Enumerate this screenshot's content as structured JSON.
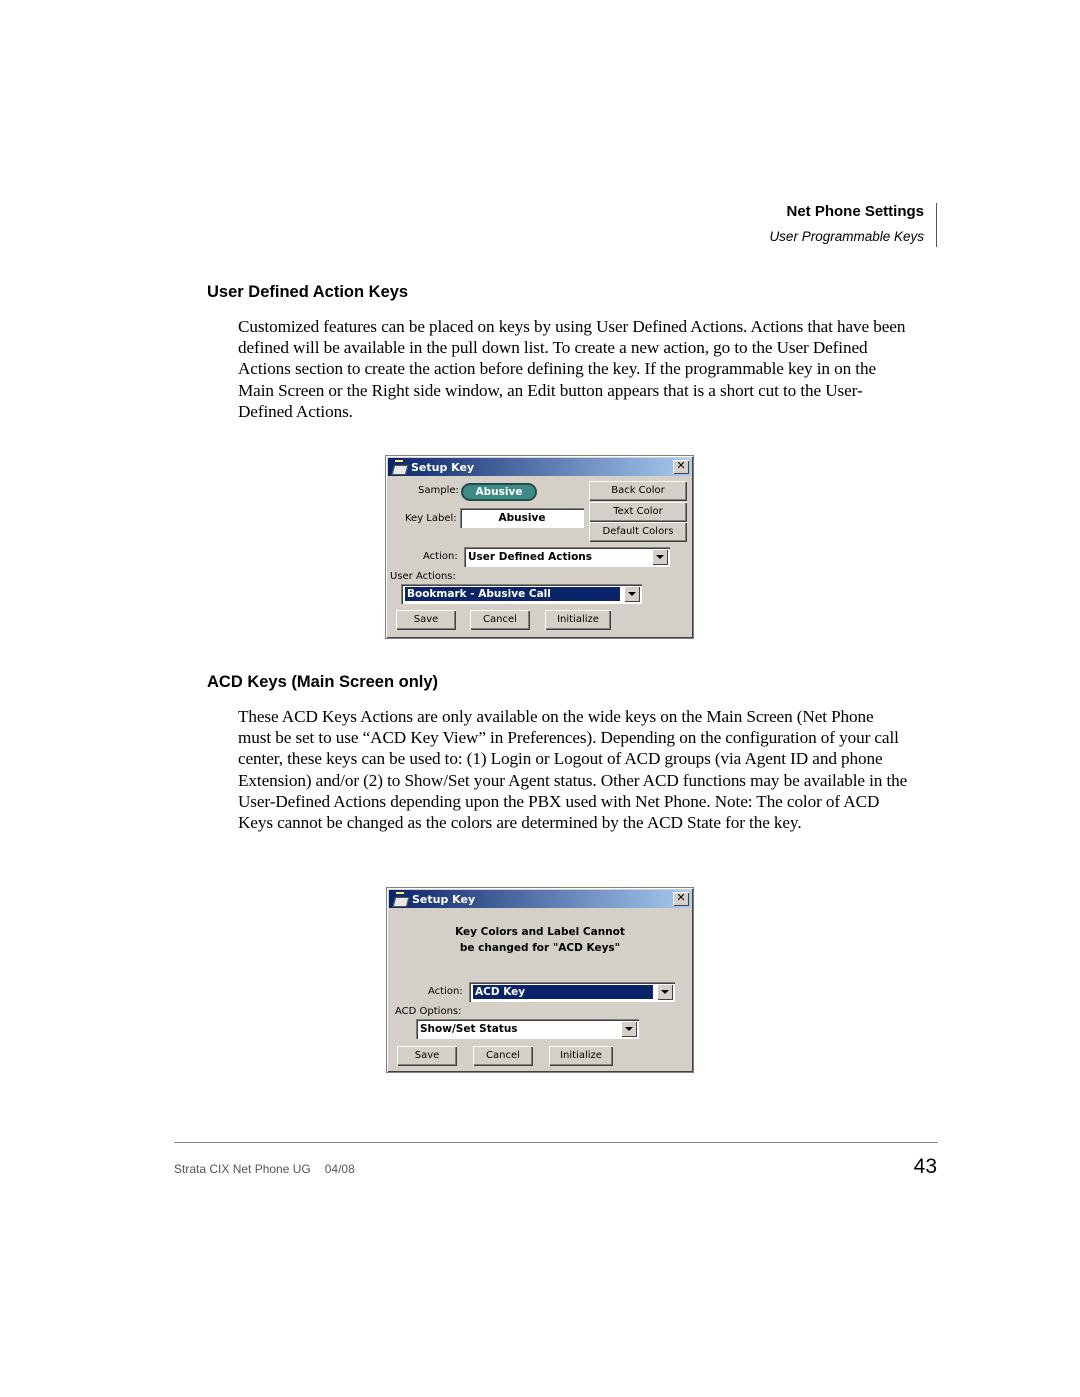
{
  "running_head": {
    "title": "Net Phone Settings",
    "subtitle": "User Programmable Keys"
  },
  "sections": [
    {
      "heading": "User Defined Action Keys",
      "paragraph": "Customized features can be placed on keys by using User Defined Actions.  Actions that have been defined will be available in the pull down list.  To create a new action, go to the User Defined Actions section to create the action before defining the key.  If the programmable key in on the Main Screen or the Right side window, an Edit button appears that is a short cut to the User-Defined Actions."
    },
    {
      "heading": "ACD Keys (Main Screen only)",
      "paragraph": "These ACD Keys Actions are only available on the wide keys on the Main Screen (Net Phone must be set to use “ACD Key View” in Preferences).  Depending on the configuration of your call center, these keys can be used to: (1) Login or Logout of ACD groups (via Agent ID and phone Extension) and/or (2) to Show/Set your Agent status.  Other ACD functions may be available in the User-Defined Actions depending upon the PBX used with Net Phone.  Note:  The color of ACD Keys cannot be changed as the colors are determined by the ACD State for the key."
    }
  ],
  "dialog1": {
    "title": "Setup Key",
    "close": "✕",
    "sample_label": "Sample:",
    "sample_value": "Abusive",
    "sample_color": "#3e8a85",
    "key_label_label": "Key Label:",
    "key_label_value": "Abusive",
    "back_color": "Back Color",
    "text_color": "Text Color",
    "default_colors": "Default Colors",
    "action_label": "Action:",
    "action_value": "User Defined Actions",
    "user_actions_label": "User Actions:",
    "user_actions_value": "Bookmark - Abusive Call",
    "save": "Save",
    "cancel": "Cancel",
    "initialize": "Initialize"
  },
  "dialog2": {
    "title": "Setup Key",
    "close": "✕",
    "message_line1": "Key Colors and Label Cannot",
    "message_line2": "be changed for \"ACD Keys\"",
    "action_label": "Action:",
    "action_value": "ACD Key",
    "acd_options_label": "ACD Options:",
    "acd_options_value": "Show/Set Status",
    "save": "Save",
    "cancel": "Cancel",
    "initialize": "Initialize"
  },
  "footer": {
    "doc_title": "Strata CIX Net Phone UG",
    "date": "04/08",
    "page_number": "43"
  }
}
